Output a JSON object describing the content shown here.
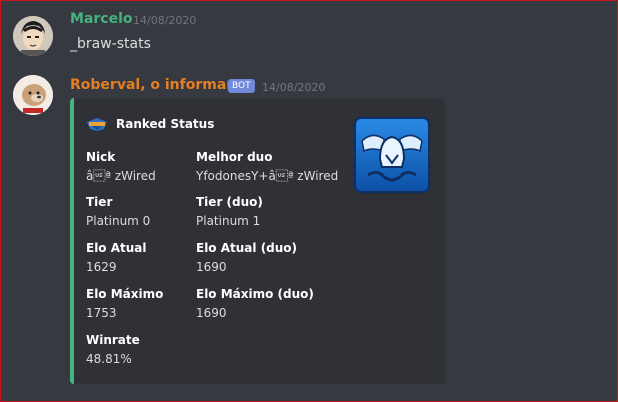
{
  "messages": [
    {
      "author": "Marcelo",
      "timestamp": "14/08/2020",
      "content": "_braw-stats",
      "name_color": "#43b581"
    },
    {
      "author": "Roberval, o informante",
      "badge": "BOT",
      "timestamp": "14/08/2020",
      "name_color": "#e67e22",
      "embed": {
        "accent_color": "#43b581",
        "author": "Ranked Status",
        "fields": [
          {
            "name": "Nick",
            "value": "â\u001fª zWired"
          },
          {
            "name": "Melhor duo",
            "value": "YfodonesY+â\u001fª zWired"
          },
          {
            "name": "Tier",
            "value": "Platinum 0"
          },
          {
            "name": "Tier (duo)",
            "value": "Platinum 1"
          },
          {
            "name": "Elo Atual",
            "value": "1629"
          },
          {
            "name": "Elo Atual (duo)",
            "value": "1690"
          },
          {
            "name": "Elo Máximo",
            "value": "1753"
          },
          {
            "name": "Elo Máximo (duo)",
            "value": "1690"
          },
          {
            "name": "Winrate",
            "value": "48.81%"
          }
        ],
        "thumbnail_icon": "winged-helmet-icon"
      }
    }
  ]
}
